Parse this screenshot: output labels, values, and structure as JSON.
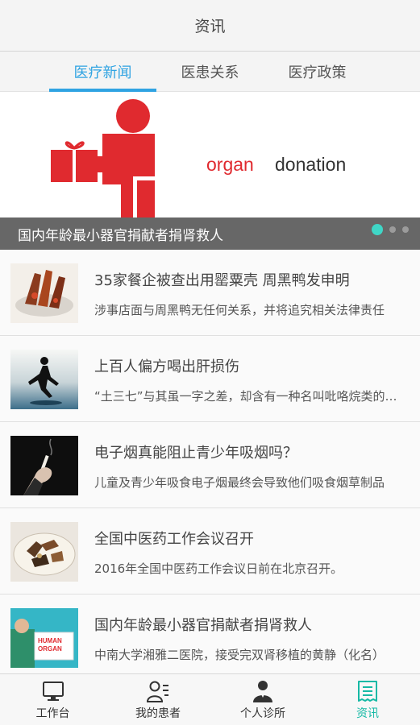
{
  "header": {
    "title": "资讯"
  },
  "tabs": [
    {
      "label": "医疗新闻",
      "active": true
    },
    {
      "label": "医患关系",
      "active": false
    },
    {
      "label": "医疗政策",
      "active": false
    }
  ],
  "banner": {
    "caption": "国内年龄最小器官捐献者捐肾救人",
    "art_text_1": "organ",
    "art_text_2": "donation",
    "slide_count": 3,
    "active_slide": 1,
    "accent": "#e02a2f"
  },
  "news": [
    {
      "title": "35家餐企被查出用罂粟壳 周黑鸭发申明",
      "summary": "涉事店面与周黑鸭无任何关系，并将追究相关法律责任",
      "thumb": "food-dish"
    },
    {
      "title": "上百人偏方喝出肝损伤",
      "summary": "“土三七”与其虽一字之差，却含有一种名叫吡咯烷类的生物碱",
      "thumb": "runner"
    },
    {
      "title": "电子烟真能阻止青少年吸烟吗？",
      "summary": "儿童及青少年吸食电子烟最终会导致他们吸食烟草制品",
      "thumb": "cigarette-hand"
    },
    {
      "title": "全国中医药工作会议召开",
      "summary": "2016年全国中医药工作会议日前在北京召开。",
      "thumb": "herbal-medicine"
    },
    {
      "title": "国内年龄最小器官捐献者捐肾救人",
      "summary": "中南大学湘雅二医院，接受完双肾移植的黄静（化名）",
      "thumb": "organ-box"
    }
  ],
  "bottom_nav": [
    {
      "label": "工作台",
      "icon": "monitor-icon",
      "active": false
    },
    {
      "label": "我的患者",
      "icon": "patients-icon",
      "active": false
    },
    {
      "label": "个人诊所",
      "icon": "doctor-icon",
      "active": false
    },
    {
      "label": "资讯",
      "icon": "news-icon",
      "active": true
    }
  ],
  "colors": {
    "tab_active": "#2fa3e2",
    "nav_active": "#16b9a5",
    "dot_active": "#3fd6c6"
  }
}
